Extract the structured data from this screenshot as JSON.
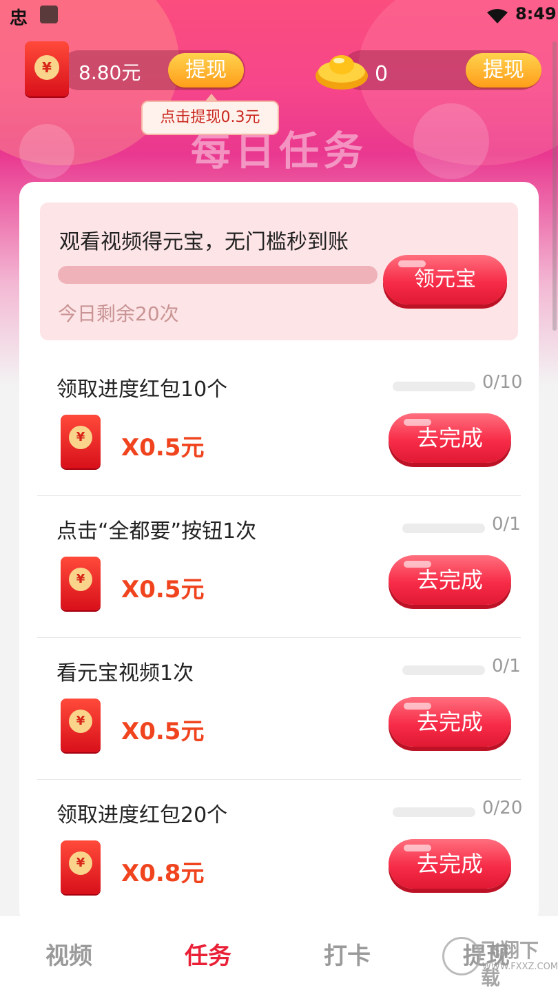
{
  "status_bar": {
    "left_glyph": "忠",
    "time": "8:49"
  },
  "header": {
    "banner_title": "每日任务",
    "wallet": {
      "amount": "8.80元",
      "withdraw_label": "提现"
    },
    "ingots": {
      "count": "0",
      "withdraw_label": "提现"
    },
    "tooltip": "点击提现0.3元"
  },
  "video_task": {
    "title": "观看视频得元宝，无门槛秒到账",
    "remaining": "今日剩余20次",
    "button": "领元宝"
  },
  "tasks": [
    {
      "title": "领取进度红包10个",
      "progress": "0/10",
      "reward": "X0.5元",
      "button": "去完成"
    },
    {
      "title": "点击“全都要”按钮1次",
      "progress": "0/1",
      "reward": "X0.5元",
      "button": "去完成"
    },
    {
      "title": "看元宝视频1次",
      "progress": "0/1",
      "reward": "X0.5元",
      "button": "去完成"
    },
    {
      "title": "领取进度红包20个",
      "progress": "0/20",
      "reward": "X0.8元",
      "button": "去完成"
    }
  ],
  "redpack_symbol": "¥",
  "bottom_nav": [
    {
      "label": "视频",
      "active": false
    },
    {
      "label": "任务",
      "active": true
    },
    {
      "label": "打卡",
      "active": false
    },
    {
      "label": "提现",
      "active": false
    }
  ],
  "watermark": {
    "text": "飞翔下载",
    "sub": "WWW.FXXZ.COM"
  },
  "colors": {
    "accent": "#ea2037",
    "reward": "#f0441f",
    "withdraw": "#ff9d1a"
  }
}
